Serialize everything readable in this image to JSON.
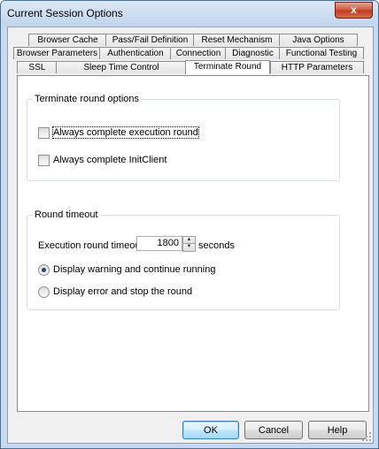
{
  "window": {
    "title": "Current Session Options",
    "close_label": "x"
  },
  "tabs": {
    "row1": [
      "Browser Cache",
      "Pass/Fail Definition",
      "Reset Mechanism",
      "Java Options"
    ],
    "row2": [
      "Browser Parameters",
      "Authentication",
      "Connection",
      "Diagnostic",
      "Functional Testing"
    ],
    "row3": [
      "SSL",
      "Sleep Time Control",
      "Terminate Round",
      "HTTP Parameters"
    ],
    "active": "Terminate Round"
  },
  "terminate_group": {
    "title": "Terminate round options",
    "always_complete_round": {
      "label": "Always complete execution round",
      "checked": false
    },
    "always_complete_initclient": {
      "label": "Always complete InitClient",
      "checked": false
    }
  },
  "timeout_group": {
    "title": "Round timeout",
    "timeout_label": "Execution round timeout:",
    "timeout_value": "1800",
    "unit": "seconds",
    "option_warning": {
      "label": "Display warning and continue running",
      "selected": true
    },
    "option_error": {
      "label": "Display error and stop the round",
      "selected": false
    }
  },
  "buttons": {
    "ok": "OK",
    "cancel": "Cancel",
    "help": "Help"
  }
}
